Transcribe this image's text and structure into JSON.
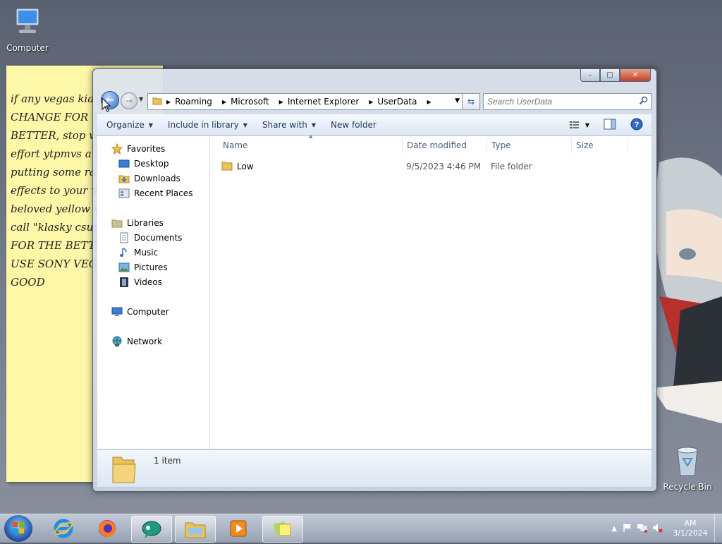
{
  "desktop": {
    "computer_label": "Computer",
    "recycle_label": "Recycle Bin"
  },
  "sticky": {
    "text": "if any vegas kia\nCHANGE FOR T\nBETTER, stop w\neffort ytpmvs a\nputting some ra\neffects to your v\nbeloved yellow e\ncall \"klasky csup\nFOR THE BETTE\nUSE SONY VEGA\nGOOD"
  },
  "window": {
    "buttons": {
      "minimize": "–",
      "maximize": "□",
      "close": "✕"
    },
    "breadcrumbs": [
      "Roaming",
      "Microsoft",
      "Internet Explorer",
      "UserData"
    ],
    "search_placeholder": "Search UserData",
    "toolbar": {
      "organize": "Organize",
      "include_in_library": "Include in library",
      "share_with": "Share with",
      "new_folder": "New folder"
    },
    "nav": {
      "favorites": "Favorites",
      "desktop": "Desktop",
      "downloads": "Downloads",
      "recent_places": "Recent Places",
      "libraries": "Libraries",
      "documents": "Documents",
      "music": "Music",
      "pictures": "Pictures",
      "videos": "Videos",
      "computer": "Computer",
      "network": "Network"
    },
    "columns": {
      "name": "Name",
      "date_modified": "Date modified",
      "type": "Type",
      "size": "Size"
    },
    "files": [
      {
        "name": "Low",
        "date_modified": "9/5/2023 4:46 PM",
        "type": "File folder",
        "size": ""
      }
    ],
    "status": {
      "item_count": "1 item"
    }
  },
  "taskbar": {
    "clock_time": "AM",
    "clock_date": "3/1/2024"
  },
  "colors": {
    "folder": "#e8c45a",
    "accent": "#2f6bc4",
    "sticky": "#fdf7a8"
  }
}
